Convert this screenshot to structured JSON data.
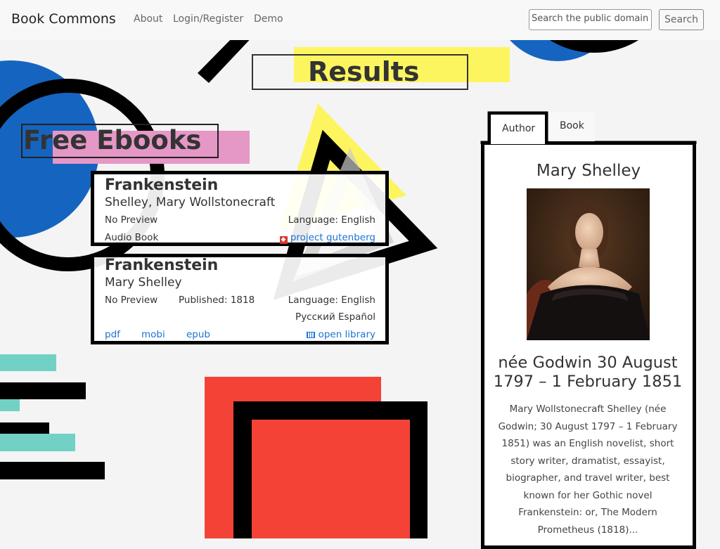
{
  "nav": {
    "brand": "Book Commons",
    "links": [
      "About",
      "Login/Register",
      "Demo"
    ],
    "search_placeholder": "Search the public domain",
    "search_button": "Search"
  },
  "headings": {
    "results": "Results",
    "free_ebooks": "Free Ebooks"
  },
  "results": [
    {
      "title": "Frankenstein",
      "author": "Shelley, Mary Wollstonecraft",
      "preview": "No Preview",
      "language": "Language: English",
      "format": "Audio Book",
      "source": "project gutenberg",
      "source_icon": "gutenberg-icon"
    },
    {
      "title": "Frankenstein",
      "author": "Mary Shelley",
      "preview": "No Preview",
      "published": "Published: 1818",
      "language": "Language: English",
      "other_languages": "Русский Español",
      "downloads": [
        "pdf",
        "mobi",
        "epub"
      ],
      "source": "open library",
      "source_icon": "open-library-icon"
    }
  ],
  "author_panel": {
    "tabs": [
      "Author",
      "Book"
    ],
    "active_tab": "Author",
    "name": "Mary Shelley",
    "dates": "née Godwin 30 August 1797 – 1 February 1851",
    "bio": "Mary Wollstonecraft Shelley (née Godwin; 30 August 1797 – 1 February 1851) was an English novelist, short story writer, dramatist, essayist, biographer, and travel writer, best known for her Gothic novel Frankenstein: or, The Modern Prometheus (1818)..."
  },
  "colors": {
    "yellow": "#fdf55f",
    "blue": "#1565c0",
    "pink": "#e597c6",
    "teal": "#72d1c5",
    "red": "#f44336",
    "black": "#000000",
    "link": "#1a73d9"
  }
}
